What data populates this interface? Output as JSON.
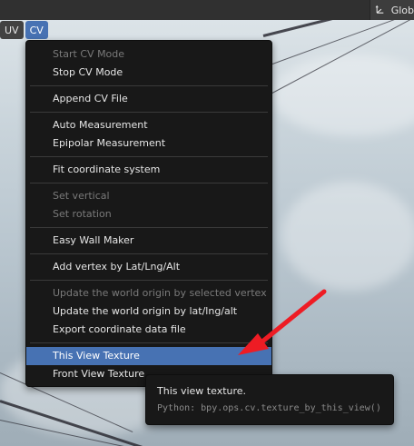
{
  "header": {
    "right_label": "Glob",
    "right_icon": "orientation-gizmo-icon"
  },
  "menubar": {
    "items": [
      {
        "label": "UV",
        "active": false
      },
      {
        "label": "CV",
        "active": true
      }
    ]
  },
  "menu": {
    "groups": [
      [
        {
          "label": "Start CV Mode",
          "enabled": false
        },
        {
          "label": "Stop CV Mode",
          "enabled": true
        }
      ],
      [
        {
          "label": "Append CV File",
          "enabled": true
        }
      ],
      [
        {
          "label": "Auto Measurement",
          "enabled": true
        },
        {
          "label": "Epipolar Measurement",
          "enabled": true
        }
      ],
      [
        {
          "label": "Fit coordinate system",
          "enabled": true
        }
      ],
      [
        {
          "label": "Set vertical",
          "enabled": false
        },
        {
          "label": "Set rotation",
          "enabled": false
        }
      ],
      [
        {
          "label": "Easy Wall Maker",
          "enabled": true
        }
      ],
      [
        {
          "label": "Add vertex by Lat/Lng/Alt",
          "enabled": true
        }
      ],
      [
        {
          "label": "Update the world origin by selected vertex",
          "enabled": false
        },
        {
          "label": "Update the world origin by lat/lng/alt",
          "enabled": true
        },
        {
          "label": "Export coordinate data file",
          "enabled": true
        }
      ],
      [
        {
          "label": "This View Texture",
          "enabled": true,
          "selected": true
        },
        {
          "label": "Front View Texture",
          "enabled": true
        }
      ]
    ]
  },
  "tooltip": {
    "title": "This view texture.",
    "python": "Python: bpy.ops.cv.texture_by_this_view()"
  },
  "colors": {
    "accent": "#4772b3",
    "menu_bg": "#181818",
    "annotation_arrow": "#ee1c24"
  }
}
